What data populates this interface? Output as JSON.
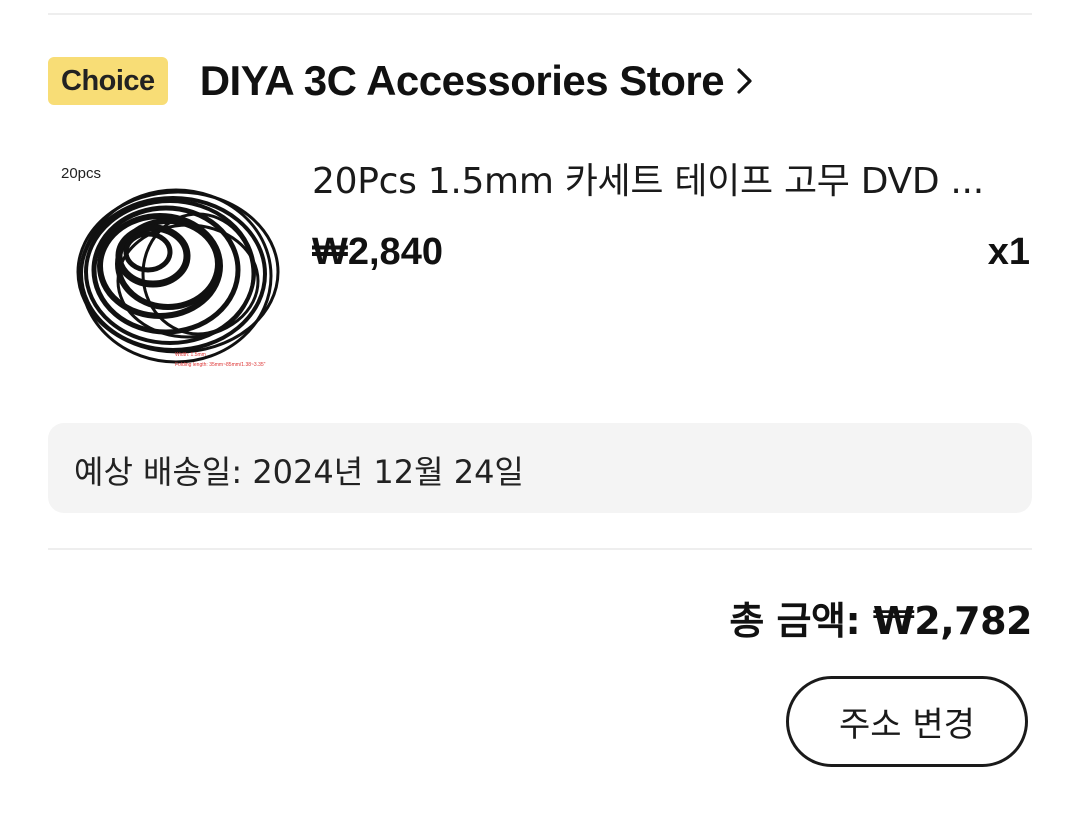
{
  "store": {
    "badge": "Choice",
    "name": "DIYA 3C Accessories Store",
    "chevron_icon": "chevron-right-icon"
  },
  "product": {
    "image_label": "20pcs",
    "image_caption_line1": "Width: 1.5mm",
    "image_caption_line2": "Folding length: 35mm~85mm/1.38~3.35\"",
    "title": "20Pcs 1.5mm 카세트 테이프 고무 DVD ...",
    "price": "₩2,840",
    "quantity": "x1"
  },
  "delivery": {
    "text": "예상 배송일: 2024년 12월 24일"
  },
  "total": {
    "text": "총 금액: ₩2,782"
  },
  "actions": {
    "change_address_label": "주소 변경"
  },
  "colors": {
    "choice_badge": "#f8dd76",
    "delivery_bg": "#f4f4f4",
    "divider": "#eeeeee"
  }
}
